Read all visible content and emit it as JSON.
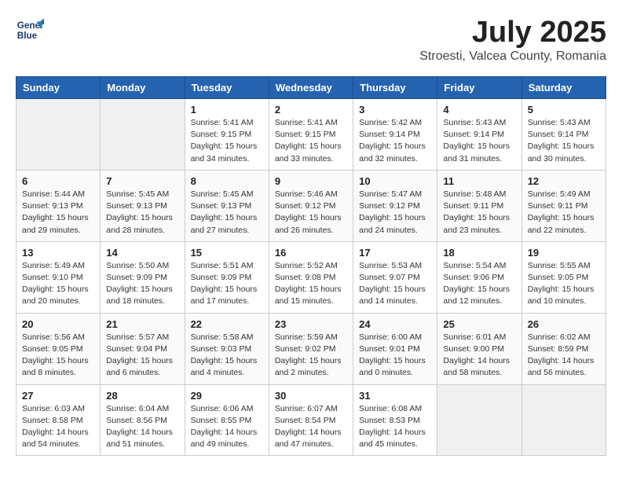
{
  "header": {
    "logo_line1": "General",
    "logo_line2": "Blue",
    "month": "July 2025",
    "location": "Stroesti, Valcea County, Romania"
  },
  "weekdays": [
    "Sunday",
    "Monday",
    "Tuesday",
    "Wednesday",
    "Thursday",
    "Friday",
    "Saturday"
  ],
  "weeks": [
    [
      {
        "day": "",
        "empty": true
      },
      {
        "day": "",
        "empty": true
      },
      {
        "day": "1",
        "sunrise": "5:41 AM",
        "sunset": "9:15 PM",
        "daylight": "15 hours and 34 minutes."
      },
      {
        "day": "2",
        "sunrise": "5:41 AM",
        "sunset": "9:15 PM",
        "daylight": "15 hours and 33 minutes."
      },
      {
        "day": "3",
        "sunrise": "5:42 AM",
        "sunset": "9:14 PM",
        "daylight": "15 hours and 32 minutes."
      },
      {
        "day": "4",
        "sunrise": "5:43 AM",
        "sunset": "9:14 PM",
        "daylight": "15 hours and 31 minutes."
      },
      {
        "day": "5",
        "sunrise": "5:43 AM",
        "sunset": "9:14 PM",
        "daylight": "15 hours and 30 minutes."
      }
    ],
    [
      {
        "day": "6",
        "sunrise": "5:44 AM",
        "sunset": "9:13 PM",
        "daylight": "15 hours and 29 minutes."
      },
      {
        "day": "7",
        "sunrise": "5:45 AM",
        "sunset": "9:13 PM",
        "daylight": "15 hours and 28 minutes."
      },
      {
        "day": "8",
        "sunrise": "5:45 AM",
        "sunset": "9:13 PM",
        "daylight": "15 hours and 27 minutes."
      },
      {
        "day": "9",
        "sunrise": "5:46 AM",
        "sunset": "9:12 PM",
        "daylight": "15 hours and 26 minutes."
      },
      {
        "day": "10",
        "sunrise": "5:47 AM",
        "sunset": "9:12 PM",
        "daylight": "15 hours and 24 minutes."
      },
      {
        "day": "11",
        "sunrise": "5:48 AM",
        "sunset": "9:11 PM",
        "daylight": "15 hours and 23 minutes."
      },
      {
        "day": "12",
        "sunrise": "5:49 AM",
        "sunset": "9:11 PM",
        "daylight": "15 hours and 22 minutes."
      }
    ],
    [
      {
        "day": "13",
        "sunrise": "5:49 AM",
        "sunset": "9:10 PM",
        "daylight": "15 hours and 20 minutes."
      },
      {
        "day": "14",
        "sunrise": "5:50 AM",
        "sunset": "9:09 PM",
        "daylight": "15 hours and 18 minutes."
      },
      {
        "day": "15",
        "sunrise": "5:51 AM",
        "sunset": "9:09 PM",
        "daylight": "15 hours and 17 minutes."
      },
      {
        "day": "16",
        "sunrise": "5:52 AM",
        "sunset": "9:08 PM",
        "daylight": "15 hours and 15 minutes."
      },
      {
        "day": "17",
        "sunrise": "5:53 AM",
        "sunset": "9:07 PM",
        "daylight": "15 hours and 14 minutes."
      },
      {
        "day": "18",
        "sunrise": "5:54 AM",
        "sunset": "9:06 PM",
        "daylight": "15 hours and 12 minutes."
      },
      {
        "day": "19",
        "sunrise": "5:55 AM",
        "sunset": "9:05 PM",
        "daylight": "15 hours and 10 minutes."
      }
    ],
    [
      {
        "day": "20",
        "sunrise": "5:56 AM",
        "sunset": "9:05 PM",
        "daylight": "15 hours and 8 minutes."
      },
      {
        "day": "21",
        "sunrise": "5:57 AM",
        "sunset": "9:04 PM",
        "daylight": "15 hours and 6 minutes."
      },
      {
        "day": "22",
        "sunrise": "5:58 AM",
        "sunset": "9:03 PM",
        "daylight": "15 hours and 4 minutes."
      },
      {
        "day": "23",
        "sunrise": "5:59 AM",
        "sunset": "9:02 PM",
        "daylight": "15 hours and 2 minutes."
      },
      {
        "day": "24",
        "sunrise": "6:00 AM",
        "sunset": "9:01 PM",
        "daylight": "15 hours and 0 minutes."
      },
      {
        "day": "25",
        "sunrise": "6:01 AM",
        "sunset": "9:00 PM",
        "daylight": "14 hours and 58 minutes."
      },
      {
        "day": "26",
        "sunrise": "6:02 AM",
        "sunset": "8:59 PM",
        "daylight": "14 hours and 56 minutes."
      }
    ],
    [
      {
        "day": "27",
        "sunrise": "6:03 AM",
        "sunset": "8:58 PM",
        "daylight": "14 hours and 54 minutes."
      },
      {
        "day": "28",
        "sunrise": "6:04 AM",
        "sunset": "8:56 PM",
        "daylight": "14 hours and 51 minutes."
      },
      {
        "day": "29",
        "sunrise": "6:06 AM",
        "sunset": "8:55 PM",
        "daylight": "14 hours and 49 minutes."
      },
      {
        "day": "30",
        "sunrise": "6:07 AM",
        "sunset": "8:54 PM",
        "daylight": "14 hours and 47 minutes."
      },
      {
        "day": "31",
        "sunrise": "6:08 AM",
        "sunset": "8:53 PM",
        "daylight": "14 hours and 45 minutes."
      },
      {
        "day": "",
        "empty": true
      },
      {
        "day": "",
        "empty": true
      }
    ]
  ]
}
